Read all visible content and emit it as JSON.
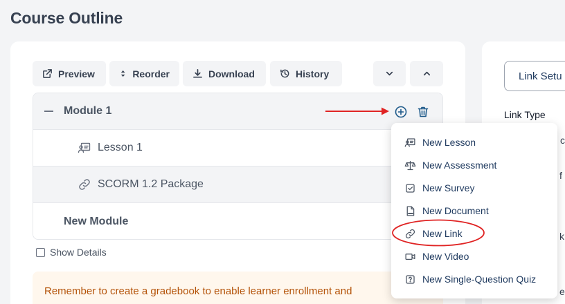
{
  "page": {
    "title": "Course Outline"
  },
  "toolbar": {
    "preview": "Preview",
    "reorder": "Reorder",
    "download": "Download",
    "history": "History"
  },
  "outline": {
    "module1": {
      "title": "Module 1"
    },
    "items": [
      {
        "label": "Lesson 1",
        "icon": "lesson-icon"
      },
      {
        "label": "SCORM 1.2 Package",
        "icon": "link-icon"
      }
    ],
    "new_module": "New Module"
  },
  "show_details": "Show Details",
  "banner": {
    "text": "Remember to create a gradebook to enable learner enrollment and"
  },
  "right_panel": {
    "link_setup": "Link Setu",
    "link_type": "Link Type",
    "fragments": [
      "c",
      "f",
      "k",
      "en"
    ]
  },
  "dropdown": {
    "items": [
      {
        "label": "New Lesson",
        "icon": "lesson-icon"
      },
      {
        "label": "New Assessment",
        "icon": "scale-icon"
      },
      {
        "label": "New Survey",
        "icon": "checkbox-icon"
      },
      {
        "label": "New Document",
        "icon": "pdf-icon"
      },
      {
        "label": "New Link",
        "icon": "link-icon"
      },
      {
        "label": "New Video",
        "icon": "video-icon"
      },
      {
        "label": "New Single-Question Quiz",
        "icon": "question-icon"
      }
    ]
  },
  "colors": {
    "annotation_red": "#e02424",
    "action_blue": "#1e5a8a",
    "banner_bg": "#fff7ed",
    "banner_text": "#b45309"
  }
}
